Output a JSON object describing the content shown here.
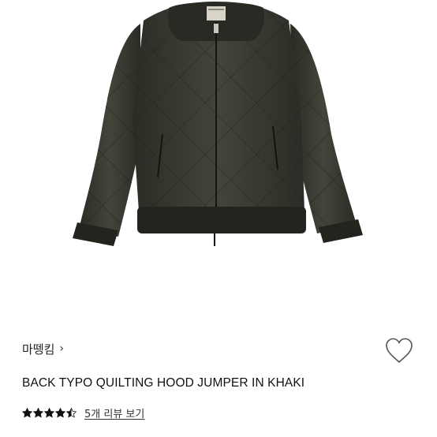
{
  "product": {
    "brand": "마뗑킴",
    "brand_chevron": "›",
    "title": "BACK TYPO QUILTING HOOD JUMPER IN KHAKI",
    "image_icon": "jacket-photo",
    "colors": {
      "jacket": "#3b3b33",
      "jacket_dark": "#22221d",
      "text": "#111111",
      "star": "#111111"
    }
  },
  "rating": {
    "stars": 4.5,
    "max_stars": 5,
    "review_link": "5개 리뷰 보기"
  },
  "wishlist": {
    "icon": "heart-outline-icon",
    "active": false
  }
}
